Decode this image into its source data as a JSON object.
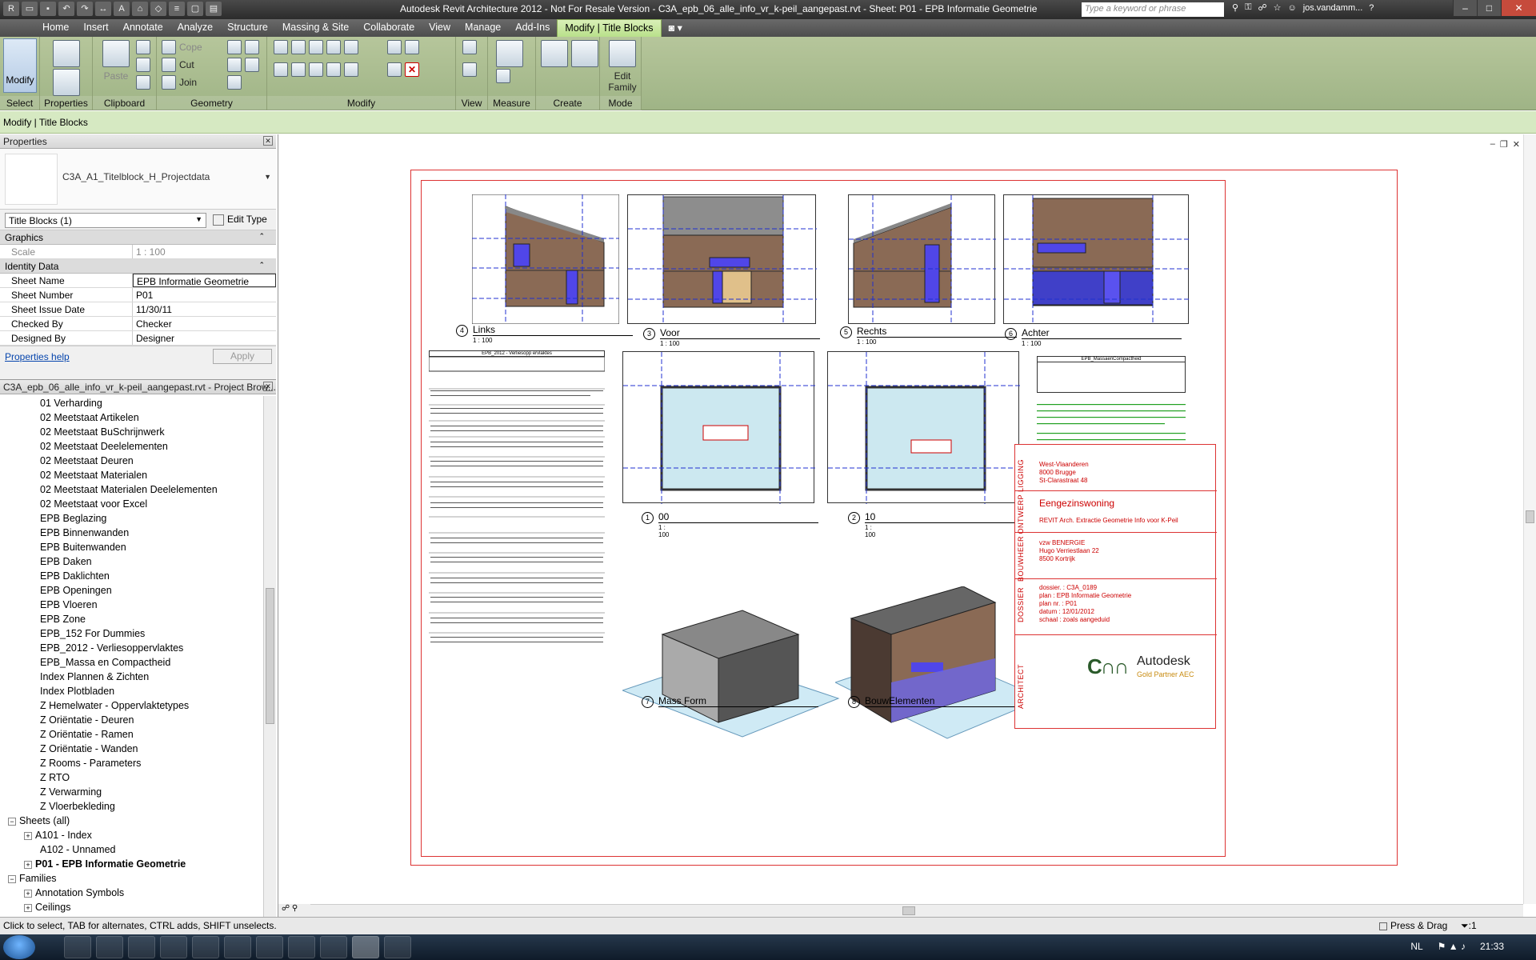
{
  "titlebar": {
    "title": "Autodesk Revit Architecture 2012 - Not For Resale Version -    C3A_epb_06_alle_info_vr_k-peil_aangepast.rvt - Sheet: P01 - EPB Informatie Geometrie",
    "search_placeholder": "Type a keyword or phrase",
    "user": "jos.vandamm..."
  },
  "ribbon_tabs": [
    "Home",
    "Insert",
    "Annotate",
    "Analyze",
    "Structure",
    "Massing & Site",
    "Collaborate",
    "View",
    "Manage",
    "Add-Ins",
    "Modify | Title Blocks"
  ],
  "ribbon": {
    "modify_label": "Modify",
    "properties_label": "Properties",
    "paste_label": "Paste",
    "cope_label": "Cope",
    "cut_label": "Cut",
    "join_label": "Join",
    "edit_family_label": "Edit Family",
    "panels": {
      "select": "Select",
      "properties": "Properties",
      "clipboard": "Clipboard",
      "geometry": "Geometry",
      "modify": "Modify",
      "view": "View",
      "measure": "Measure",
      "create": "Create",
      "mode": "Mode"
    }
  },
  "options_bar": "Modify | Title Blocks",
  "properties": {
    "header": "Properties",
    "type_name": "C3A_A1_Titelblock_H_Projectdata",
    "filter": "Title Blocks (1)",
    "edit_type": "Edit Type",
    "groups": {
      "graphics": "Graphics",
      "identity": "Identity Data"
    },
    "scale": {
      "label": "Scale",
      "value": "1 : 100"
    },
    "rows": [
      {
        "label": "Sheet Name",
        "value": "EPB Informatie Geometrie"
      },
      {
        "label": "Sheet Number",
        "value": "P01"
      },
      {
        "label": "Sheet Issue Date",
        "value": "11/30/11"
      },
      {
        "label": "Checked By",
        "value": "Checker"
      },
      {
        "label": "Designed By",
        "value": "Designer"
      }
    ],
    "help": "Properties help",
    "apply": "Apply"
  },
  "browser": {
    "header": "C3A_epb_06_alle_info_vr_k-peil_aangepast.rvt - Project Brow...",
    "items": [
      "01 Verharding",
      "02 Meetstaat Artikelen",
      "02 Meetstaat BuSchrijnwerk",
      "02 Meetstaat Deelelementen",
      "02 Meetstaat Deuren",
      "02 Meetstaat Materialen",
      "02 Meetstaat Materialen Deelelementen",
      "02 Meetstaat voor Excel",
      "EPB Beglazing",
      "EPB Binnenwanden",
      "EPB Buitenwanden",
      "EPB Daken",
      "EPB Daklichten",
      "EPB Openingen",
      "EPB Vloeren",
      "EPB Zone",
      "EPB_152  For Dummies",
      "EPB_2012 - Verliesoppervlaktes",
      "EPB_Massa en Compactheid",
      "Index Plannen & Zichten",
      "Index Plotbladen",
      "Z Hemelwater - Oppervlaktetypes",
      "Z Oriëntatie - Deuren",
      "Z Oriëntatie - Ramen",
      "Z Oriëntatie - Wanden",
      "Z Rooms - Parameters",
      "Z RTO",
      "Z Verwarming",
      "Z Vloerbekleding"
    ],
    "sheets_label": "Sheets (all)",
    "sheets": [
      "A101 - Index",
      "A102 - Unnamed",
      "P01 - EPB Informatie Geometrie"
    ],
    "families_label": "Families",
    "families": [
      "Annotation Symbols",
      "Ceilings"
    ]
  },
  "sheet": {
    "views": [
      {
        "num": "4",
        "name": "Links",
        "scale": "1 : 100"
      },
      {
        "num": "3",
        "name": "Voor",
        "scale": "1 : 100"
      },
      {
        "num": "5",
        "name": "Rechts",
        "scale": "1 : 100"
      },
      {
        "num": "6",
        "name": "Achter",
        "scale": "1 : 100"
      },
      {
        "num": "1",
        "name": "00",
        "scale": "1 : 100"
      },
      {
        "num": "2",
        "name": "10",
        "scale": "1 : 100"
      },
      {
        "num": "7",
        "name": "Mass Form",
        "scale": ""
      },
      {
        "num": "8",
        "name": "BouwElementen",
        "scale": ""
      }
    ],
    "schedule_title": "EPB_2012 - Verliesopp ervlaktes",
    "compact_title": "EPB_MassaenCompactheid",
    "titleblock": {
      "ligging_label": "LIGGING",
      "ligging": [
        "West-Vlaanderen",
        "8000    Brugge",
        "St-Clarastraat 48"
      ],
      "ontwerp_label": "ONTWERP",
      "project": "Eengezinswoning",
      "project_sub": "REVIT Arch. Extractie Geometrie Info voor K-Peil",
      "bouwheer_label": "BOUWHEER",
      "bouwheer": [
        "vzw    BENERGIE",
        "Hugo Verriestlaan 22",
        "8500  Kortrijk"
      ],
      "dossier_label": "DOSSIER",
      "dossier": [
        "dossier.  :   C3A_0189",
        "plan        :   EPB Informatie Geometrie",
        "plan nr.   :   P01",
        "datum      :   12/01/2012",
        "schaal     :   zoals aangeduid"
      ],
      "architect_label": "ARCHITECT",
      "logo_name": "Autodesk",
      "logo_sub": "Gold Partner AEC"
    }
  },
  "statusbar": {
    "hint": "Click to select, TAB for alternates, CTRL adds, SHIFT unselects.",
    "press_drag": "Press & Drag",
    "filter": ":1"
  },
  "taskbar": {
    "lang": "NL",
    "time": "21:33"
  }
}
